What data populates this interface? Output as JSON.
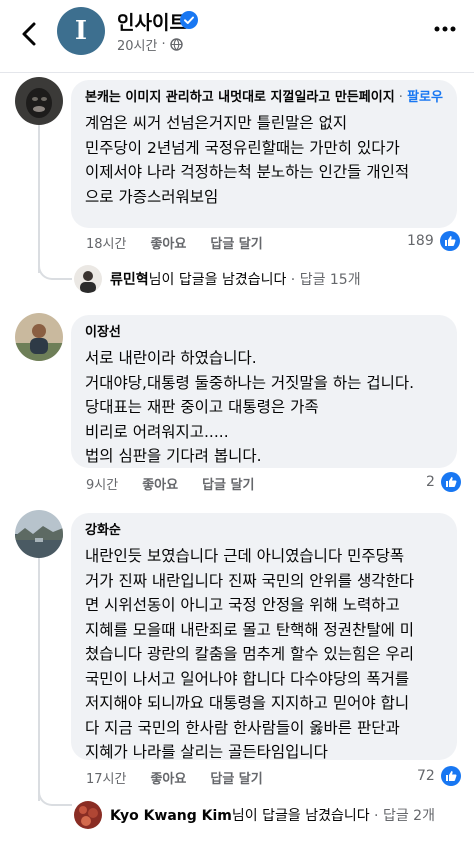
{
  "header": {
    "page_name": "인사이트",
    "avatar_letter": "I",
    "time": "20시간",
    "sep": "·",
    "brand_color": "#3d6f8f"
  },
  "comments": [
    {
      "author": "본캐는 이미지 관리하고 내멋대로 지껄일라고 만든페이지",
      "dot": " · ",
      "follow": "팔로우",
      "text": "계엄은 씨거 선넘은거지만 틀린말은 없지\n민주당이 2년넘게 국정유린할때는 가만히 있다가\n이제서야 나라 걱정하는척 분노하는 인간들 개인적\n으로 가증스러워보임",
      "time": "18시간",
      "like": "좋아요",
      "reply": "답글 달기",
      "likes": "189",
      "replies": {
        "name": "류민혁",
        "rest": "님이 답글을 남겼습니다",
        "count": " · 답글 15개"
      }
    },
    {
      "author": "이장선",
      "text": "서로 내란이라 하였습니다.\n거대야당,대통령 둘중하나는 거짓말을 하는 겁니다.\n당대표는 재판 중이고 대통령은 가족\n비리로 어려워지고.....\n법의 심판을 기다려 봅니다.",
      "time": "9시간",
      "like": "좋아요",
      "reply": "답글 달기",
      "likes": "2"
    },
    {
      "author": "강화순",
      "text": "내란인듯 보였습니다 근데 아니였습니다 민주당폭\n거가 진짜 내란입니다 진짜 국민의 안위를 생각한다\n면 시위선동이 아니고 국정 안정을 위해 노력하고\n지혜를 모을때 내란죄로 몰고 탄핵해 정권찬탈에 미\n쳤습니다 광란의 칼춤을 멈추게 할수 있는힘은 우리\n국민이 나서고 일어나야 합니다 다수야당의 폭거를\n저지해야 되니까요 대통령을 지지하고 믿어야 합니\n다 지금 국민의 한사람 한사람들이 옳바른 판단과\n지혜가 나라를 살리는 골든타임입니다",
      "time": "17시간",
      "like": "좋아요",
      "reply": "답글 달기",
      "likes": "72",
      "replies": {
        "name": "Kyo Kwang Kim",
        "rest": "님이 답글을 남겼습니다",
        "count": " · 답글 2개"
      }
    }
  ]
}
